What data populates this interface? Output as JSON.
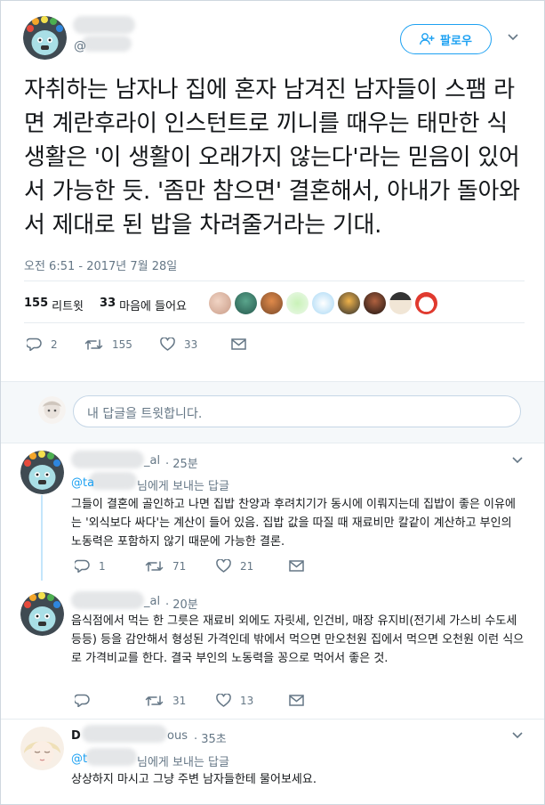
{
  "main_tweet": {
    "handle_prefix": "@",
    "follow_label": "팔로우",
    "text": "자취하는 남자나 집에 혼자 남겨진 남자들이 스팸 라면 계란후라이 인스턴트로 끼니를 때우는 태만한 식생활은 '이 생활이 오래가지 않는다'라는 믿음이 있어서 가능한 듯. '좀만 참으면' 결혼해서, 아내가 돌아와서 제대로 된 밥을 차려줄거라는 기대.",
    "timestamp": "오전 6:51 - 2017년 7월 28일",
    "retweet_count": "155",
    "retweet_label": "리트윗",
    "like_count": "33",
    "like_label": "마음에 들어요",
    "action_reply_count": "2",
    "action_retweet_count": "155",
    "action_like_count": "33"
  },
  "reply_box": {
    "placeholder": "내 답글을 트윗합니다."
  },
  "replies": [
    {
      "name_suffix": "_al",
      "time": "· 25분",
      "to_prefix": "@ta",
      "to_suffix": "님에게 보내는 답글",
      "text": "그들이 결혼에 골인하고 나면 집밥 찬양과 후려치기가 동시에 이뤄지는데 집밥이 좋은 이유에는 '외식보다 싸다'는 계산이 들어 있음. 집밥 값을 따질 때 재료비만 칼같이 계산하고 부인의 노동력은 포함하지 않기 때문에 가능한 결론.",
      "reply_count": "1",
      "retweet_count": "71",
      "like_count": "21"
    },
    {
      "name_suffix": "_al",
      "time": "· 20분",
      "text": "음식점에서 먹는 한 그릇은 재료비 외에도 자릿세, 인건비, 매장 유지비(전기세 가스비 수도세 등등) 등을 감안해서 형성된 가격인데 밖에서 먹으면 만오천원 집에서 먹으면 오천원 이런 식으로 가격비교를 한다. 결국 부인의 노동력을 꽁으로 먹어서 좋은 것.",
      "reply_count": "",
      "retweet_count": "31",
      "like_count": "13"
    },
    {
      "name_prefix": "D",
      "name_suffix": "ous",
      "time": "· 35초",
      "to_prefix": "@t",
      "to_suffix": "님에게 보내는 답글",
      "text": "상상하지 마시고 그냥 주변 남자들한테 물어보세요."
    }
  ],
  "colors": {
    "accent": "#1da1f2",
    "muted": "#657786",
    "text": "#14171a",
    "thread_line": "#c4e6fb",
    "band": "#f5f8fa"
  },
  "icons": [
    "user-plus-icon",
    "chevron-down-icon",
    "reply-icon",
    "retweet-icon",
    "like-icon",
    "message-icon"
  ]
}
